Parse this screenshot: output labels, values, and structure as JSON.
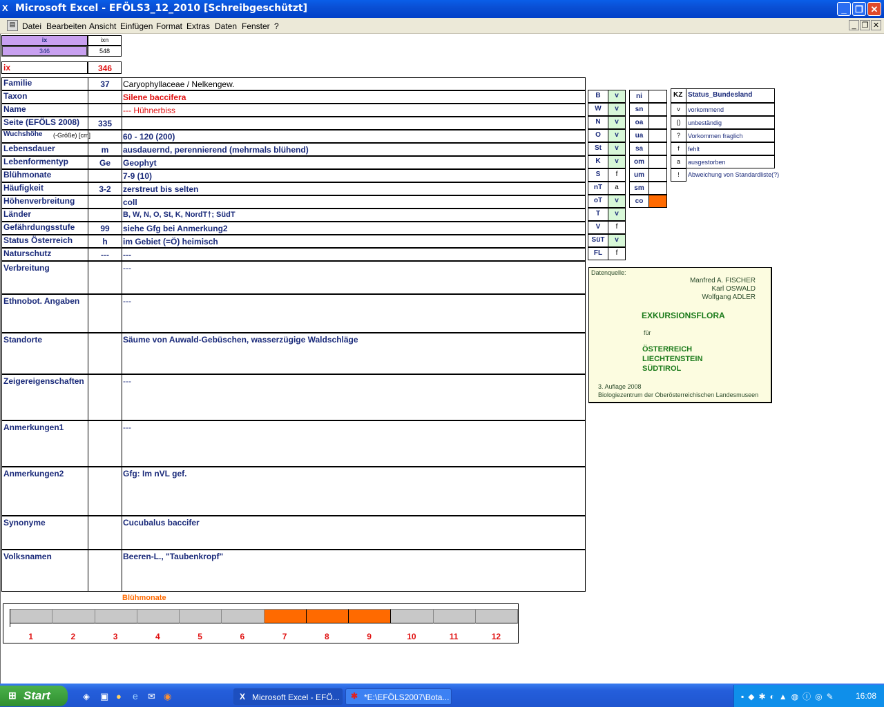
{
  "window": {
    "title": "Microsoft Excel - EFÖLS3_12_2010  [Schreibgeschützt]"
  },
  "menu": [
    "Datei",
    "Bearbeiten",
    "Ansicht",
    "Einfügen",
    "Format",
    "Extras",
    "Daten",
    "Fenster",
    "?"
  ],
  "top": {
    "ix_hdr": "ix",
    "ixn_hdr": "ixn",
    "ix_val": "346",
    "ixn_val": "548",
    "ix_label": "ix",
    "ix_big": "346"
  },
  "rows": [
    {
      "label": "Familie",
      "code": "37",
      "value": "Caryophyllaceae  /  Nelkengew."
    },
    {
      "label": "Taxon",
      "code": "",
      "value": "Silene baccifera"
    },
    {
      "label": "Name",
      "code": "",
      "value": "--- Hühnerbiss"
    },
    {
      "label": "Seite (EFÖLS 2008)",
      "code": "335",
      "value": ""
    },
    {
      "label": "Wuchshöhe",
      "label_small": "(-Größe) [cm]",
      "code": "",
      "value": " 60 - 120 (200)"
    },
    {
      "label": "Lebensdauer",
      "code": "m",
      "value": "ausdauernd, perennierend (mehrmals blühend)"
    },
    {
      "label": "Lebenformentyp",
      "code": "Ge",
      "value": "Geophyt"
    },
    {
      "label": "Blühmonate",
      "code": "",
      "value": " 7-9 (10)"
    },
    {
      "label": "Häufigkeit",
      "code": "3-2",
      "value": "zerstreut bis selten"
    },
    {
      "label": "Höhenverbreitung",
      "code": "",
      "value": "coll"
    },
    {
      "label": "Länder",
      "code": "",
      "value": "B, W, N, O, St, K, NordT†; SüdT"
    },
    {
      "label": "Gefährdungsstufe",
      "code": "99",
      "value": "siehe Gfg bei Anmerkung2"
    },
    {
      "label": "Status Österreich",
      "code": "h",
      "value": "im Gebiet (=Ö) heimisch"
    },
    {
      "label": "Naturschutz",
      "code": "---",
      "value": "---"
    }
  ],
  "big_rows": [
    {
      "label": "Verbreitung",
      "value": "---"
    },
    {
      "label": "Ethnobot. Angaben",
      "value": "---"
    },
    {
      "label": "Standorte",
      "value": "Säume von Auwald-Gebüschen, wasserzügige Waldschläge"
    },
    {
      "label": "Zeigereigenschaften",
      "value": "---"
    },
    {
      "label": "Anmerkungen1",
      "value": "---"
    },
    {
      "label": "Anmerkungen2",
      "value": "Gfg: Im nVL gef."
    },
    {
      "label": "Synonyme",
      "value": "Cucubalus baccifer"
    },
    {
      "label": "Volksnamen",
      "value": "Beeren-L., \"Taubenkropf\""
    }
  ],
  "states": [
    {
      "k": "B",
      "v": "v"
    },
    {
      "k": "W",
      "v": "v"
    },
    {
      "k": "N",
      "v": "v"
    },
    {
      "k": "O",
      "v": "v"
    },
    {
      "k": "St",
      "v": "v"
    },
    {
      "k": "K",
      "v": "v"
    },
    {
      "k": "S",
      "v": "f"
    },
    {
      "k": "nT",
      "v": "a"
    },
    {
      "k": "oT",
      "v": "v"
    },
    {
      "k": "T",
      "v": "v"
    },
    {
      "k": "V",
      "v": "f"
    },
    {
      "k": "SüT",
      "v": "v"
    },
    {
      "k": "FL",
      "v": "f"
    }
  ],
  "heights": [
    "ni",
    "sn",
    "oa",
    "ua",
    "sa",
    "om",
    "um",
    "sm",
    "co"
  ],
  "legend": {
    "kz": "KZ",
    "title": "Status_Bundesland",
    "items": [
      {
        "k": "v",
        "t": "vorkommend"
      },
      {
        "k": "()",
        "t": "unbeständig"
      },
      {
        "k": "?",
        "t": "Vorkommen fraglich"
      },
      {
        "k": "f",
        "t": "fehlt"
      },
      {
        "k": "a",
        "t": "ausgestorben"
      },
      {
        "k": "!",
        "t": "Abweichung von Standardliste(?)"
      }
    ]
  },
  "source": {
    "label": "Datenquelle:",
    "authors": [
      "Manfred A. FISCHER",
      "Karl OSWALD",
      "Wolfgang ADLER"
    ],
    "title": "EXKURSIONSFLORA",
    "fuer": "für",
    "countries": [
      "ÖSTERREICH",
      "LIECHTENSTEIN",
      "SÜDTIROL"
    ],
    "edition": "3. Auflage 2008",
    "publisher": "Biologiezentrum der Oberösterreichischen Landesmuseen"
  },
  "bloom": {
    "title": "Blühmonate",
    "months": [
      "1",
      "2",
      "3",
      "4",
      "5",
      "6",
      "7",
      "8",
      "9",
      "10",
      "11",
      "12"
    ],
    "active": [
      7,
      8,
      9
    ],
    "color_active": "#ff6a00",
    "color_inactive": "#c8c8c8"
  },
  "taskbar": {
    "start": "Start",
    "tasks": [
      "Microsoft Excel - EFÖ...",
      "*E:\\EFÖLS2007\\Bota..."
    ],
    "clock": "16:08"
  }
}
